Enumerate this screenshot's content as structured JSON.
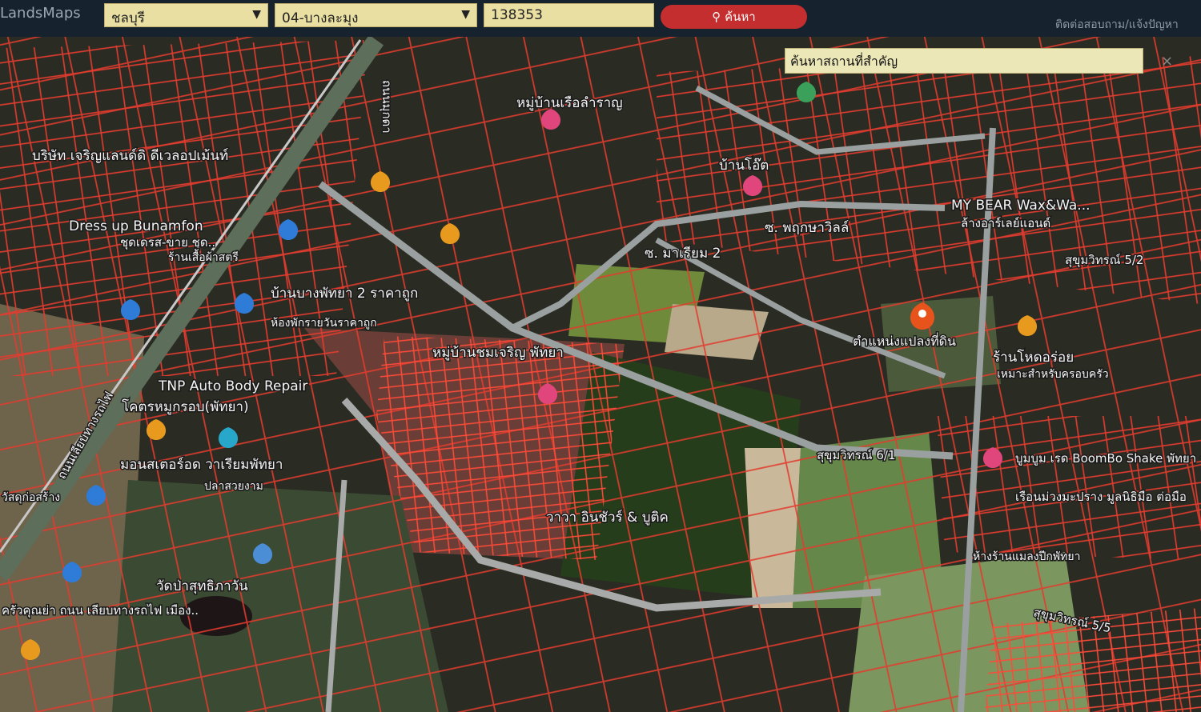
{
  "app": {
    "logo_text": "LandsMaps"
  },
  "search": {
    "province": "ชลบุรี",
    "district": "04-บางละมุง",
    "parcel_no": "138353",
    "button_label": "ค้นหา",
    "place_search_placeholder": "ค้นหาสถานที่สำคัญ",
    "close_symbol": "×"
  },
  "top_right_text": "ติดต่อสอบถาม/แจ้งปัญหา",
  "colors": {
    "parcel_line": "#e33b2e",
    "topbar": "#16222e",
    "button": "#c52e2e",
    "input_bg": "#e9dfa2"
  },
  "map": {
    "labels": [
      "หมู่บ้านเรือลำราญ",
      "บริษัท เจริญแลนด์ดิ ดีเวลอปเม้นท์",
      "บ้านโอ๊ต",
      "MY BEAR Wax&Wa...",
      "ล้างอาร์เลย์แอนด์",
      "Dress up Bunamfon",
      "ชุดเดรส-ขาย ชุด..",
      "ร้านเสื้อผ้าสตรี",
      "ซ. พฤกษาวิลล์",
      "ซ. มาเรียม 2",
      "สุขุมวิทรณ์ 5/2",
      "บ้านบางพัทยา 2 ราคาถูก",
      "ห้องพักรายวันราคาถูก",
      "ตำแหน่งแปลงที่ดิน",
      "หมู่บ้านชมเจริญ พัทยา",
      "ร้านโหดอร่อย",
      "เหมาะสำหรับครอบครัว",
      "TNP Auto Body Repair",
      "โคตรหมูกรอบ(พัทยา)",
      "มอนสเตอร์อด วาเรียมพัทยา",
      "ปลาสวยงาม",
      "สุขุมวิทรณ์ 6/1",
      "บูมบูม เรด BoomBo Shake พัทยา ราคาถูก",
      "เรือนม่วงมะปราง มูลนิธิมือ ต่อมือ",
      "วาวา อินชัวร์ & บูติค",
      "วัดป่าสุทธิภาวัน",
      "ครัวคุณย่า ถนน เลียบทางรถไฟ เมือง..",
      "ถนนเลียบทางรถไฟ",
      "ถนนมุกดา",
      "สุขุมวิทรณ์ 5/5",
      "ห้างร้านแมลงปีกพัทยา",
      "วัสดุก่อสร้าง"
    ],
    "markers": [
      {
        "icon": "restaurant-pin-icon",
        "color": "#e89a1e"
      },
      {
        "icon": "restaurant-pin-icon",
        "color": "#e89a1e"
      },
      {
        "icon": "restaurant-pin-icon",
        "color": "#e89a1e"
      },
      {
        "icon": "restaurant-pin-icon",
        "color": "#e89a1e"
      },
      {
        "icon": "restaurant-pin-icon",
        "color": "#e89a1e"
      },
      {
        "icon": "shopping-pin-icon",
        "color": "#2f7bd8"
      },
      {
        "icon": "shopping-pin-icon",
        "color": "#2f7bd8"
      },
      {
        "icon": "shopping-pin-icon",
        "color": "#2f7bd8"
      },
      {
        "icon": "shopping-pin-icon",
        "color": "#2f7bd8"
      },
      {
        "icon": "shopping-pin-icon",
        "color": "#2f7bd8"
      },
      {
        "icon": "store-pin-icon",
        "color": "#e0457b"
      },
      {
        "icon": "store-pin-icon",
        "color": "#e0457b"
      },
      {
        "icon": "store-pin-icon",
        "color": "#e0457b"
      },
      {
        "icon": "store-pin-icon",
        "color": "#e0457b"
      },
      {
        "icon": "aquarium-pin-icon",
        "color": "#27a7c9"
      },
      {
        "icon": "temple-pin-icon",
        "color": "#4c8ed6"
      },
      {
        "icon": "location-pin-icon",
        "color": "#e8531c"
      },
      {
        "icon": "place-pin-icon",
        "color": "#3aa05a"
      }
    ]
  }
}
